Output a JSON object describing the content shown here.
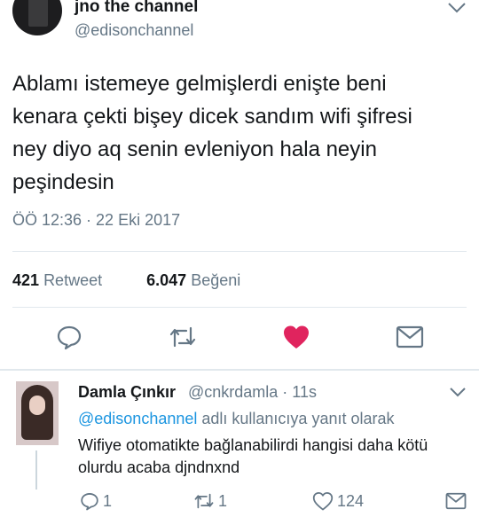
{
  "tweet": {
    "display_name": "jno the channel",
    "handle": "@edisonchannel",
    "text_lines": [
      "Ablamı istemeye gelmişlerdi enişte beni",
      "kenara çekti bişey dicek sandım wifi şifresi",
      "ney diyo aq senin evleniyon hala neyin",
      "peşindesin"
    ],
    "timestamp": "ÖÖ 12:36 · 22 Eki 2017",
    "retweet_count": "421",
    "retweet_label": "Retweet",
    "like_count": "6.047",
    "like_label": "Beğeni",
    "icons": [
      "chevron-down-icon",
      "reply-icon",
      "retweet-icon",
      "heart-icon",
      "message-icon"
    ],
    "like_color": "#e0245e"
  },
  "reply": {
    "display_name": "Damla Çınkır",
    "meta": "@cnkrdamla · 11s",
    "reply_to_mention": "@edisonchannel",
    "reply_to_suffix": " adlı kullanıcıya yanıt olarak",
    "text_lines": [
      "Wifiye otomatikte bağlanabilirdi hangisi daha kötü",
      "olurdu acaba djndnxnd"
    ],
    "reply_count": "1",
    "retweet_count": "1",
    "like_count": "124"
  },
  "colors": {
    "text": "#14171a",
    "secondary": "#657786",
    "link": "#1b95e0",
    "divider": "#e1e8ed"
  }
}
